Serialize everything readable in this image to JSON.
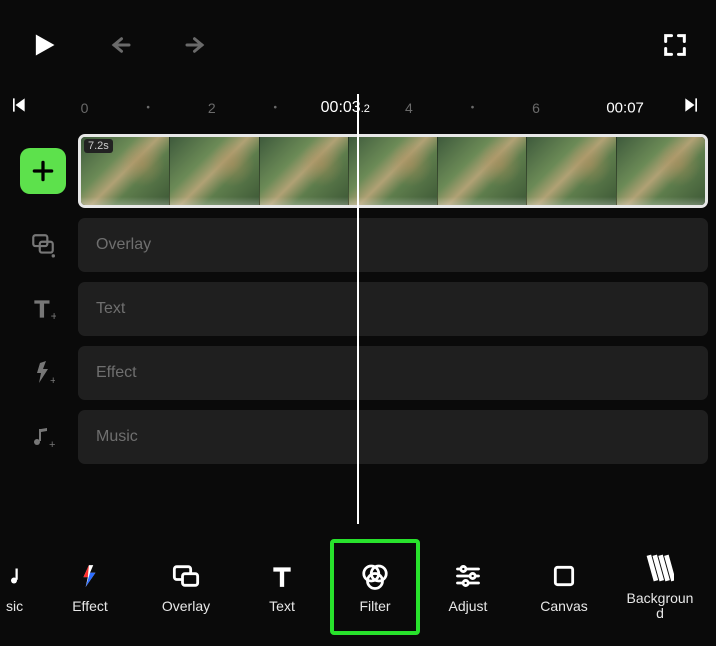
{
  "controls": {
    "play": "play",
    "undo": "undo",
    "redo": "redo",
    "fullscreen": "fullscreen",
    "prev_marker": "prev",
    "next_marker": "next"
  },
  "ruler": {
    "ticks": [
      "0",
      "2",
      "4",
      "6"
    ],
    "current_time_main": "00:03",
    "current_time_sub": ".2",
    "total_time": "00:07"
  },
  "clip": {
    "duration_badge": "7.2s"
  },
  "tracks": [
    {
      "id": "overlay",
      "label": "Overlay"
    },
    {
      "id": "text",
      "label": "Text"
    },
    {
      "id": "effect",
      "label": "Effect"
    },
    {
      "id": "music",
      "label": "Music"
    }
  ],
  "bottom_tools": {
    "music_partial": "sic",
    "effect": "Effect",
    "overlay": "Overlay",
    "text": "Text",
    "filter": "Filter",
    "adjust": "Adjust",
    "canvas": "Canvas",
    "background": "Backgroun\nd"
  }
}
